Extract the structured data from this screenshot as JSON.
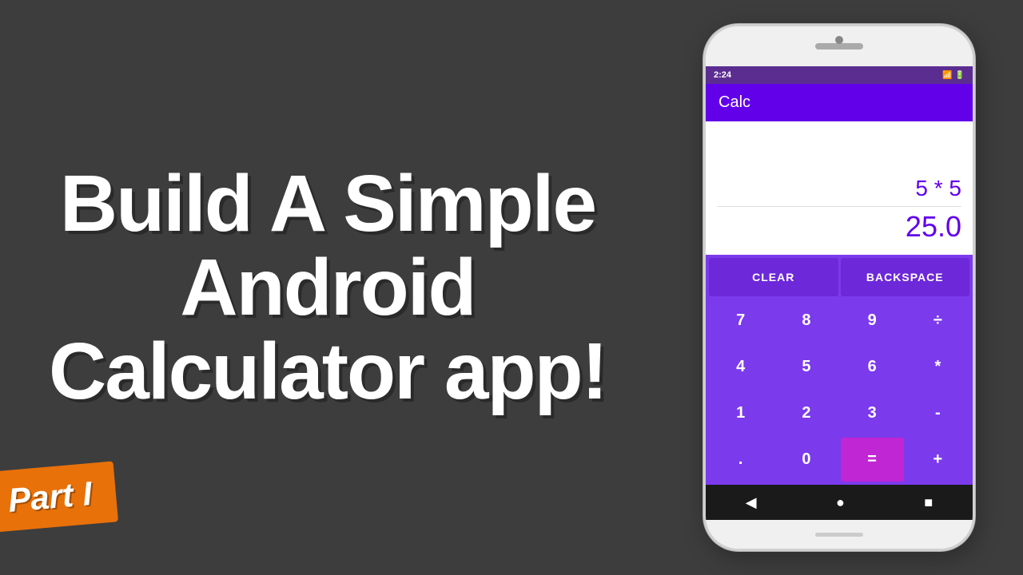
{
  "left": {
    "title_line1": "Build A Simple",
    "title_line2": "Android",
    "title_line3": "Calculator app!",
    "badge_text": "Part I"
  },
  "phone": {
    "status": {
      "time": "2:24",
      "icons": "▾◾"
    },
    "toolbar_title": "Calc",
    "display": {
      "expression": "5 * 5",
      "result": "25.0"
    },
    "keys": [
      {
        "label": "CLEAR",
        "type": "wide clear",
        "id": "clear"
      },
      {
        "label": "BACKSPACE",
        "type": "wide backspace",
        "id": "backspace"
      },
      {
        "label": "7",
        "type": "digit",
        "id": "7"
      },
      {
        "label": "8",
        "type": "digit",
        "id": "8"
      },
      {
        "label": "9",
        "type": "digit",
        "id": "9"
      },
      {
        "label": "÷",
        "type": "operator",
        "id": "divide"
      },
      {
        "label": "4",
        "type": "digit",
        "id": "4"
      },
      {
        "label": "5",
        "type": "digit",
        "id": "5"
      },
      {
        "label": "6",
        "type": "digit",
        "id": "6"
      },
      {
        "label": "*",
        "type": "operator",
        "id": "multiply"
      },
      {
        "label": "1",
        "type": "digit",
        "id": "1"
      },
      {
        "label": "2",
        "type": "digit",
        "id": "2"
      },
      {
        "label": "3",
        "type": "digit",
        "id": "3"
      },
      {
        "label": "-",
        "type": "operator",
        "id": "subtract"
      },
      {
        "label": ".",
        "type": "digit",
        "id": "dot"
      },
      {
        "label": "0",
        "type": "digit",
        "id": "0"
      },
      {
        "label": "=",
        "type": "equals",
        "id": "equals"
      },
      {
        "label": "+",
        "type": "operator",
        "id": "add"
      }
    ],
    "nav": {
      "back": "◀",
      "home": "●",
      "recent": "■"
    }
  }
}
